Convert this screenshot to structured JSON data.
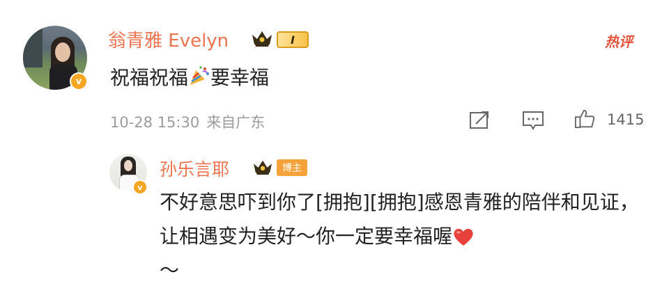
{
  "main_comment": {
    "username": "翁青雅 Evelyn",
    "level_badge": "I",
    "hot_tag": "热评",
    "text_before_emoji": "祝福祝福",
    "emoji": "party-popper",
    "text_after_emoji": "要幸福",
    "timestamp": "10-28 15:30",
    "source": "来自广东",
    "like_count": "1415",
    "verified_badge": "v"
  },
  "reply": {
    "username": "孙乐言耶",
    "author_tag": "博主",
    "verified_badge": "v",
    "text": "不好意思吓到你了[拥抱][拥抱]感恩青雅的陪伴和见证，让相遇变为美好～你一定要幸福喔",
    "text_tail": "～",
    "emoji": "red-heart"
  },
  "colors": {
    "username": "#eb7350",
    "hot_tag": "#e3533c",
    "meta_text": "#9b9b9b",
    "body_text": "#222222",
    "verified": "#f5a623",
    "author_tag": "#f5a23a"
  },
  "icons": [
    "crown-icon",
    "repost-icon",
    "comment-icon",
    "like-icon",
    "party-popper-emoji",
    "heart-emoji"
  ]
}
